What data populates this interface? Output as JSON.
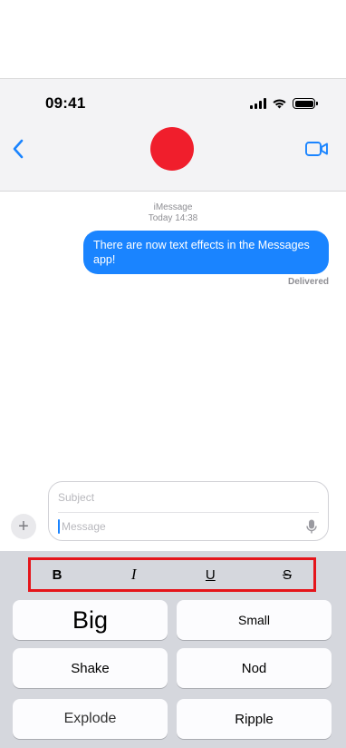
{
  "status": {
    "time": "09:41"
  },
  "header": {
    "avatar_color": "#f01e2c",
    "accent_color": "#1a84ff"
  },
  "conversation": {
    "service_label": "iMessage",
    "timestamp": "Today 14:38",
    "messages": [
      {
        "text": "There are now text effects in the Messages app!",
        "sender": "me"
      }
    ],
    "delivery_status": "Delivered"
  },
  "composer": {
    "subject_placeholder": "Subject",
    "message_placeholder": "Message",
    "plus_label": "+"
  },
  "format_bar": {
    "highlight_color": "#e5151b",
    "bold": "B",
    "italic": "I",
    "underline": "U",
    "strikethrough": "S"
  },
  "effects": {
    "big": "Big",
    "small": "Small",
    "shake": "Shake",
    "nod": "Nod",
    "explode": "Explode",
    "ripple": "Ripple"
  }
}
